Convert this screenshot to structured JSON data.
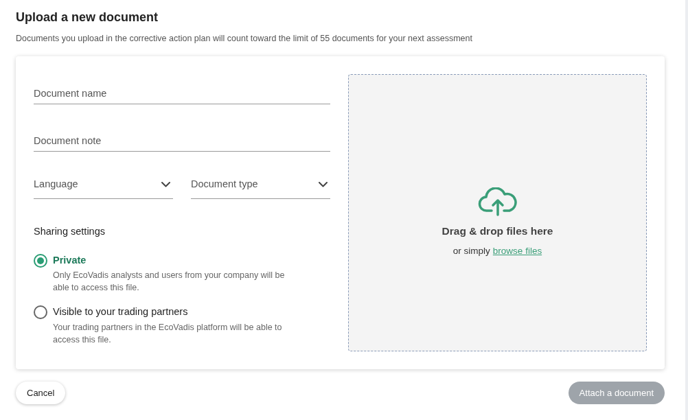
{
  "title": "Upload a new document",
  "subtitle": "Documents you upload in the corrective action plan will count toward the limit of 55 documents for your next assessment",
  "text_fields": [
    {
      "placeholder": "Document name"
    },
    {
      "placeholder": "Document note"
    }
  ],
  "selects": [
    {
      "placeholder": "Language"
    },
    {
      "placeholder": "Document type"
    }
  ],
  "sharing": {
    "label": "Sharing settings",
    "options": [
      {
        "label": "Private",
        "description": "Only EcoVadis analysts and users from your company will be able to access this file.",
        "selected": true
      },
      {
        "label": "Visible to your trading partners",
        "description": "Your trading partners in the EcoVadis platform will be able to access this file.",
        "selected": false
      }
    ]
  },
  "dropzone": {
    "heading": "Drag & drop files here",
    "prefix": "or simply",
    "link": "browse files"
  },
  "buttons": {
    "cancel": {
      "label": "Cancel",
      "disabled": false
    },
    "attach": {
      "label": "Attach a document",
      "disabled": true
    }
  }
}
